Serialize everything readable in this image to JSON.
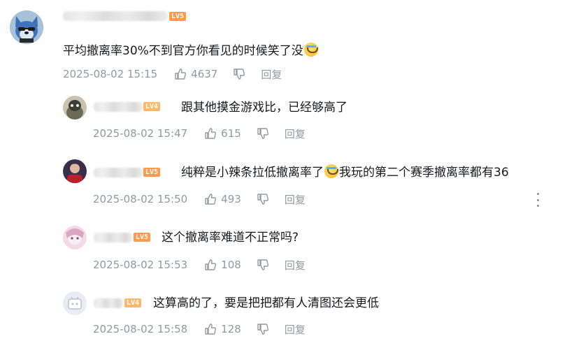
{
  "main_comment": {
    "level": "LV5",
    "text": "平均撤离率30%不到官方你看见的时候笑了没",
    "emoji": "laugh-cry-emoji",
    "time": "2025-08-02 15:15",
    "likes": "4637",
    "reply_label": "回复"
  },
  "replies": [
    {
      "level": "LV4",
      "text": "跟其他摸金游戏比，已经够高了",
      "time": "2025-08-02 15:47",
      "likes": "615",
      "reply_label": "回复"
    },
    {
      "level": "LV5",
      "text_before_emoji": "纯粹是小辣条拉低撤离率了",
      "text_after_emoji": "我玩的第二个赛季撤离率都有36",
      "emoji": "laugh-cry-emoji",
      "time": "2025-08-02 15:50",
      "likes": "493",
      "reply_label": "回复"
    },
    {
      "level": "LV5",
      "text": "这个撤离率难道不正常吗?",
      "time": "2025-08-02 15:53",
      "likes": "108",
      "reply_label": "回复"
    },
    {
      "level": "LV4",
      "text": "这算高的了，要是把把都有人清图还会更低",
      "time": "2025-08-02 15:58",
      "likes": "128",
      "reply_label": "回复"
    }
  ],
  "colors": {
    "text": "#18191c",
    "meta": "#9499a0",
    "lv5": "#ff9a4e",
    "lv4": "#ffb96a"
  }
}
